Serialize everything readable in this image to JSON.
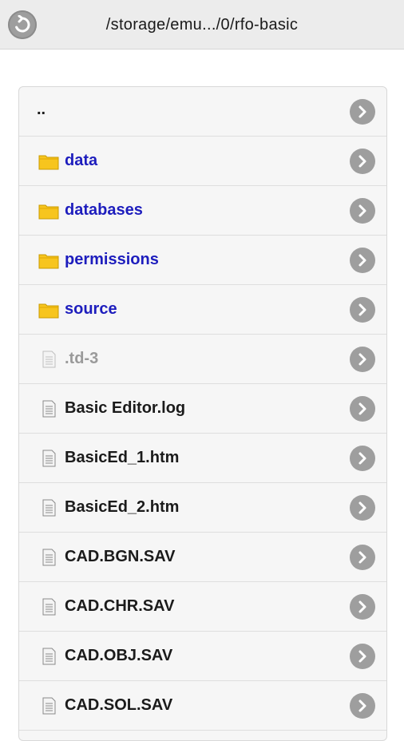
{
  "header": {
    "title": "/storage/emu.../0/rfo-basic",
    "back_icon": "back-arrow-icon"
  },
  "colors": {
    "folder_text": "#1d1dbd",
    "file_text": "#1b1b1b",
    "hidden_text": "#9a9a9a",
    "chevron_bg": "#9e9e9e"
  },
  "list": {
    "items": [
      {
        "label": "..",
        "type": "parent"
      },
      {
        "label": "data",
        "type": "folder"
      },
      {
        "label": "databases",
        "type": "folder"
      },
      {
        "label": "permissions",
        "type": "folder"
      },
      {
        "label": "source",
        "type": "folder"
      },
      {
        "label": ".td-3",
        "type": "hidden"
      },
      {
        "label": "Basic Editor.log",
        "type": "file"
      },
      {
        "label": "BasicEd_1.htm",
        "type": "file"
      },
      {
        "label": "BasicEd_2.htm",
        "type": "file"
      },
      {
        "label": "CAD.BGN.SAV",
        "type": "file"
      },
      {
        "label": "CAD.CHR.SAV",
        "type": "file"
      },
      {
        "label": "CAD.OBJ.SAV",
        "type": "file"
      },
      {
        "label": "CAD.SOL.SAV",
        "type": "file"
      }
    ]
  }
}
